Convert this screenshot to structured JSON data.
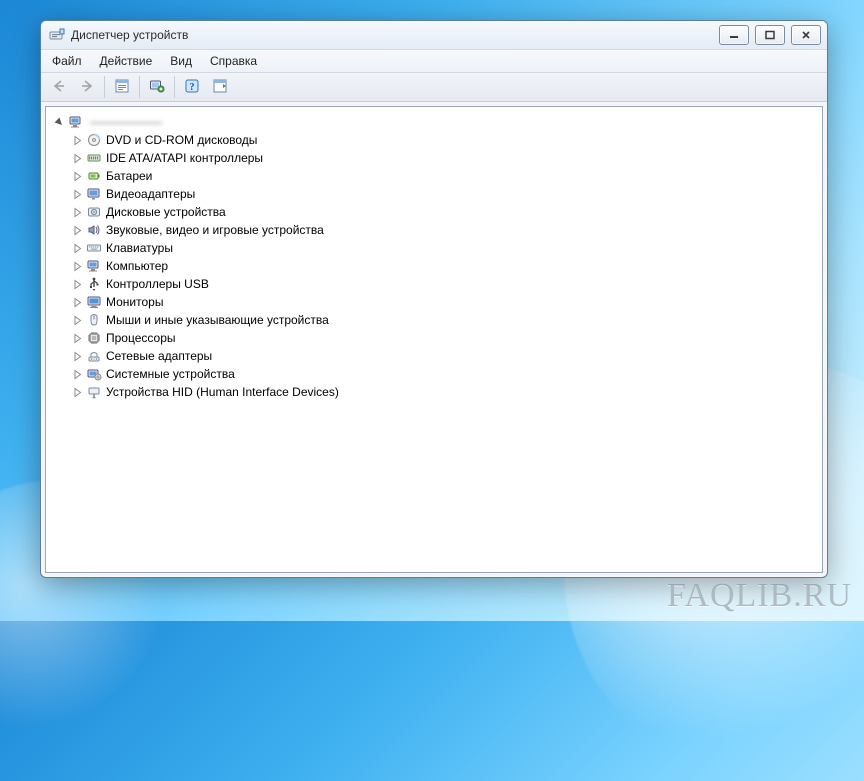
{
  "window": {
    "title": "Диспетчер устройств"
  },
  "menu": {
    "file": "Файл",
    "action": "Действие",
    "view": "Вид",
    "help": "Справка"
  },
  "tree": {
    "root": {
      "name": "—"
    },
    "categories": [
      {
        "icon": "disc",
        "label": "DVD и CD-ROM дисководы"
      },
      {
        "icon": "ide",
        "label": "IDE ATA/ATAPI контроллеры"
      },
      {
        "icon": "battery",
        "label": "Батареи"
      },
      {
        "icon": "display",
        "label": "Видеоадаптеры"
      },
      {
        "icon": "hdd",
        "label": "Дисковые устройства"
      },
      {
        "icon": "audio",
        "label": "Звуковые, видео и игровые устройства"
      },
      {
        "icon": "keyboard",
        "label": "Клавиатуры"
      },
      {
        "icon": "computer",
        "label": "Компьютер"
      },
      {
        "icon": "usb",
        "label": "Контроллеры USB"
      },
      {
        "icon": "monitor",
        "label": "Мониторы"
      },
      {
        "icon": "mouse",
        "label": "Мыши и иные указывающие устройства"
      },
      {
        "icon": "cpu",
        "label": "Процессоры"
      },
      {
        "icon": "network",
        "label": "Сетевые адаптеры"
      },
      {
        "icon": "system",
        "label": "Системные устройства"
      },
      {
        "icon": "hid",
        "label": "Устройства HID (Human Interface Devices)"
      }
    ]
  },
  "watermark": "FAQLIB.RU"
}
